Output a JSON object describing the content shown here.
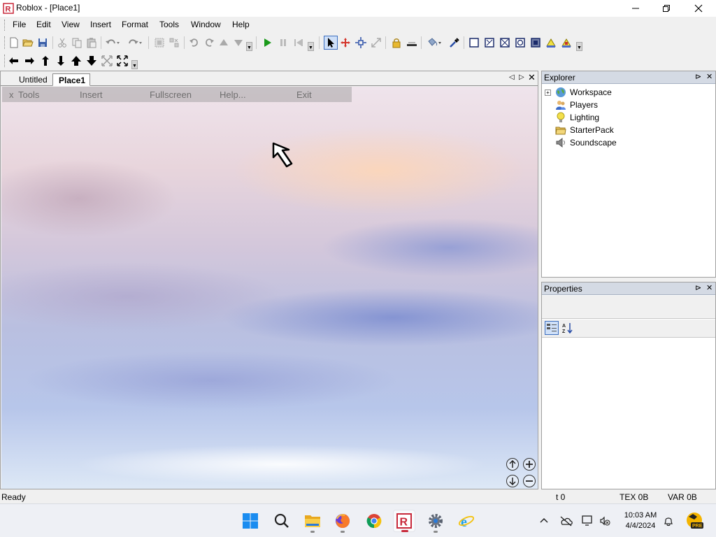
{
  "window": {
    "title": "Roblox - [Place1]",
    "controls": {
      "minimize": "minimize",
      "maximize": "maximize",
      "close": "close"
    }
  },
  "menubar": {
    "items": [
      "File",
      "Edit",
      "View",
      "Insert",
      "Format",
      "Tools",
      "Window",
      "Help"
    ]
  },
  "toolbar1": {
    "icons": [
      "new-file-icon",
      "open-folder-icon",
      "save-icon",
      "cut-icon",
      "copy-icon",
      "paste-icon",
      "undo-icon",
      "redo-icon",
      "group-icon",
      "ungroup-icon",
      "rotate-left-icon",
      "rotate-right-icon",
      "move-up-icon",
      "move-down-icon",
      "play-icon",
      "pause-icon",
      "reset-icon",
      "select-icon",
      "drag-icon",
      "move-icon",
      "resize-icon",
      "lock-icon",
      "anchor-icon",
      "paint-bucket-icon",
      "dropper-icon",
      "surface-smooth-icon",
      "surface-glue-icon",
      "surface-weld-icon",
      "surface-studs-icon",
      "surface-inlet-icon",
      "surface-hinge-icon",
      "surface-motor-icon"
    ]
  },
  "toolbar2": {
    "icons": [
      "pan-left-icon",
      "pan-right-icon",
      "tilt-up-icon",
      "tilt-down-icon",
      "zoom-in-arrow-icon",
      "zoom-out-arrow-icon",
      "zoom-extents-icon",
      "fullscreen-icon"
    ]
  },
  "document": {
    "tabs": [
      {
        "label": "Untitled",
        "active": false
      },
      {
        "label": "Place1",
        "active": true
      }
    ],
    "ingame_menu": {
      "close": "x",
      "items": [
        "Tools",
        "Insert",
        "Fullscreen",
        "Help...",
        "Exit"
      ]
    },
    "camera_controls": [
      "tilt-up-icon",
      "zoom-in-icon",
      "tilt-down-icon",
      "zoom-out-icon"
    ]
  },
  "explorer": {
    "title": "Explorer",
    "items": [
      {
        "label": "Workspace",
        "icon": "globe-icon",
        "expandable": true,
        "expander": "+"
      },
      {
        "label": "Players",
        "icon": "players-icon",
        "expandable": false
      },
      {
        "label": "Lighting",
        "icon": "lightbulb-icon",
        "expandable": false
      },
      {
        "label": "StarterPack",
        "icon": "folder-icon",
        "expandable": false
      },
      {
        "label": "Soundscape",
        "icon": "speaker-icon",
        "expandable": false
      }
    ]
  },
  "properties": {
    "title": "Properties",
    "sort_buttons": [
      "categorized-sort-icon",
      "alphabetical-sort-icon"
    ]
  },
  "statusbar": {
    "status": "Ready",
    "time": "t 0",
    "tex": "TEX 0B",
    "var": "VAR 0B"
  },
  "taskbar": {
    "apps": [
      "windows-start-icon",
      "search-icon",
      "file-explorer-icon",
      "firefox-icon",
      "chrome-icon",
      "roblox-icon",
      "settings-icon",
      "internet-explorer-icon"
    ],
    "clock_time": "10:03 AM",
    "clock_date": "4/4/2024",
    "pre_badge": "PRE"
  },
  "colors": {
    "roblox_red": "#c8283a",
    "panel_header": "#d4dae4",
    "play_green": "#1a9a1a"
  }
}
